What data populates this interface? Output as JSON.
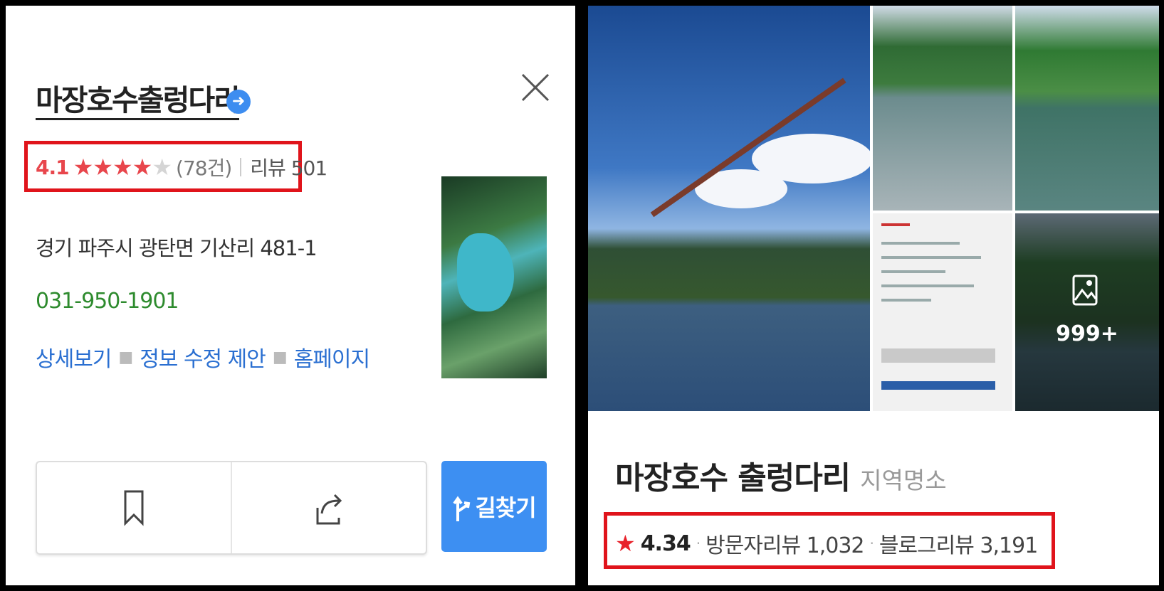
{
  "left_card": {
    "title": "마장호수출렁다리",
    "rating": {
      "score": "4.1",
      "stars_filled": 4,
      "stars_total": 5,
      "count": "(78건)",
      "review": "리뷰 501"
    },
    "address": "경기 파주시 광탄면 기산리 481-1",
    "phone": "031-950-1901",
    "links": [
      "상세보기",
      "정보 수정 제안",
      "홈페이지"
    ],
    "route_label": "길찾기",
    "icons": [
      "arrow-right-circle-icon",
      "close-icon",
      "bookmark-icon",
      "share-icon",
      "route-icon"
    ],
    "accent": "#3d8df0",
    "star_color": "#e8464c",
    "phone_color": "#2e8b2e",
    "link_color": "#2a6fd1"
  },
  "right_card": {
    "photo_more": "999+",
    "name": "마장호수 출렁다리",
    "category": "지역명소",
    "rating": {
      "score": "4.34",
      "visitor_reviews": "방문자리뷰 1,032",
      "blog_reviews": "블로그리뷰 3,191"
    },
    "icons": [
      "star-icon",
      "image-icon"
    ],
    "star_color": "#e8212a"
  },
  "highlight_color": "#e0141b"
}
